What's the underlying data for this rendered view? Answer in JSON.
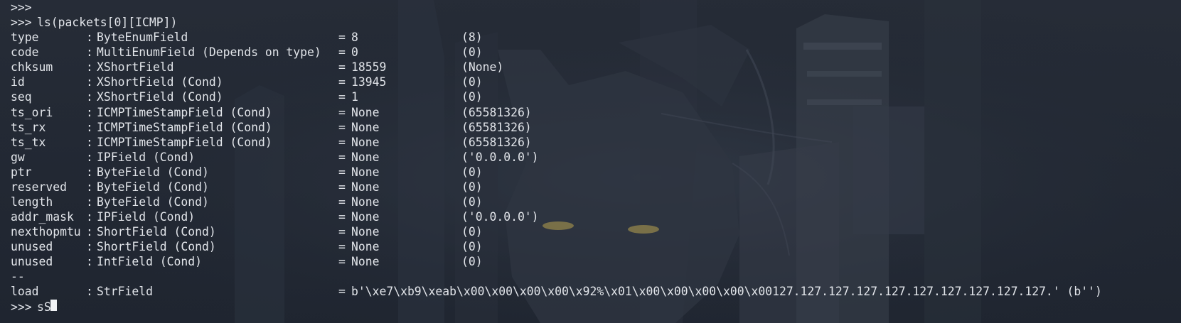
{
  "terminal": {
    "prompt": ">>>",
    "empty_prompt": ">>>",
    "command": "ls(packets[0][ICMP])",
    "colon": ":",
    "equals": "=",
    "fields": [
      {
        "name": "type",
        "type": "ByteEnumField",
        "value": "8",
        "default": "(8)"
      },
      {
        "name": "code",
        "type": "MultiEnumField (Depends on type)",
        "value": "0",
        "default": "(0)"
      },
      {
        "name": "chksum",
        "type": "XShortField",
        "value": "18559",
        "default": "(None)"
      },
      {
        "name": "id",
        "type": "XShortField (Cond)",
        "value": "13945",
        "default": "(0)"
      },
      {
        "name": "seq",
        "type": "XShortField (Cond)",
        "value": "1",
        "default": "(0)"
      },
      {
        "name": "ts_ori",
        "type": "ICMPTimeStampField (Cond)",
        "value": "None",
        "default": "(65581326)"
      },
      {
        "name": "ts_rx",
        "type": "ICMPTimeStampField (Cond)",
        "value": "None",
        "default": "(65581326)"
      },
      {
        "name": "ts_tx",
        "type": "ICMPTimeStampField (Cond)",
        "value": "None",
        "default": "(65581326)"
      },
      {
        "name": "gw",
        "type": "IPField (Cond)",
        "value": "None",
        "default": "('0.0.0.0')"
      },
      {
        "name": "ptr",
        "type": "ByteField (Cond)",
        "value": "None",
        "default": "(0)"
      },
      {
        "name": "reserved",
        "type": "ByteField (Cond)",
        "value": "None",
        "default": "(0)"
      },
      {
        "name": "length",
        "type": "ByteField (Cond)",
        "value": "None",
        "default": "(0)"
      },
      {
        "name": "addr_mask",
        "type": "IPField (Cond)",
        "value": "None",
        "default": "('0.0.0.0')"
      },
      {
        "name": "nexthopmtu",
        "type": "ShortField (Cond)",
        "value": "None",
        "default": "(0)"
      },
      {
        "name": "unused",
        "type": "ShortField (Cond)",
        "value": "None",
        "default": "(0)"
      },
      {
        "name": "unused",
        "type": "IntField (Cond)",
        "value": "None",
        "default": "(0)"
      }
    ],
    "separator": "--",
    "payload": {
      "name": "load",
      "type": "StrField",
      "value": "b'\\xe7\\xb9\\xeab\\x00\\x00\\x00\\x00\\x92%\\x01\\x00\\x00\\x00\\x00\\x00127.127.127.127.127.127.127.127.127.127.' (b'')"
    },
    "input_text": "sS"
  },
  "colors": {
    "background": "#242a35",
    "text": "#e2e5ea",
    "cursor": "#f0f2f5",
    "eye_glow": "#b8a24e"
  }
}
